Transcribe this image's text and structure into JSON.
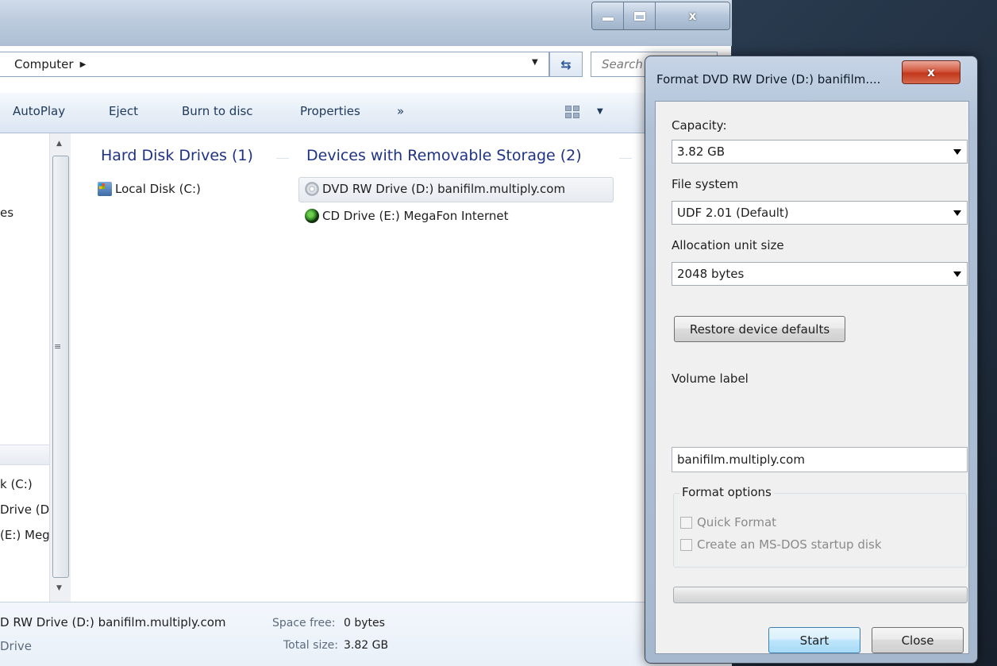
{
  "explorer": {
    "breadcrumb": "Computer",
    "search_placeholder": "Search C",
    "toolbar": {
      "autoplay": "AutoPlay",
      "eject": "Eject",
      "burn": "Burn to disc",
      "properties": "Properties",
      "more": "»"
    },
    "nav_items": [
      "es",
      "k (C:)",
      "Drive (D",
      "(E:) Meg"
    ],
    "groups": [
      {
        "header": "Hard Disk Drives (1)",
        "drives": [
          {
            "label": "Local Disk (C:)",
            "icon": "hard-disk-icon"
          }
        ]
      },
      {
        "header": "Devices with Removable Storage (2)",
        "drives": [
          {
            "label": "DVD RW Drive (D:) banifilm.multiply.com",
            "icon": "dvd-drive-icon",
            "selected": true
          },
          {
            "label": "CD Drive (E:) MegaFon Internet",
            "icon": "cd-drive-icon"
          }
        ]
      }
    ],
    "details": {
      "name": "D RW Drive (D:) banifilm.multiply.com",
      "type": "Drive",
      "space_free_label": "Space free:",
      "space_free_value": "0 bytes",
      "total_size_label": "Total size:",
      "total_size_value": "3.82 GB"
    }
  },
  "format_dialog": {
    "title": "Format DVD RW Drive (D:) banifilm....",
    "close_glyph": "x",
    "capacity_label": "Capacity:",
    "capacity_value": "3.82 GB",
    "filesystem_label": "File system",
    "filesystem_value": "UDF 2.01 (Default)",
    "allocation_label": "Allocation unit size",
    "allocation_value": "2048 bytes",
    "restore_button": "Restore device defaults",
    "volume_label_label": "Volume label",
    "volume_label_value": "banifilm.multiply.com",
    "format_options_label": "Format options",
    "quick_format": "Quick Format",
    "msdos_startup": "Create an MS-DOS startup disk",
    "progress": 0,
    "start_button": "Start",
    "close_button": "Close"
  }
}
